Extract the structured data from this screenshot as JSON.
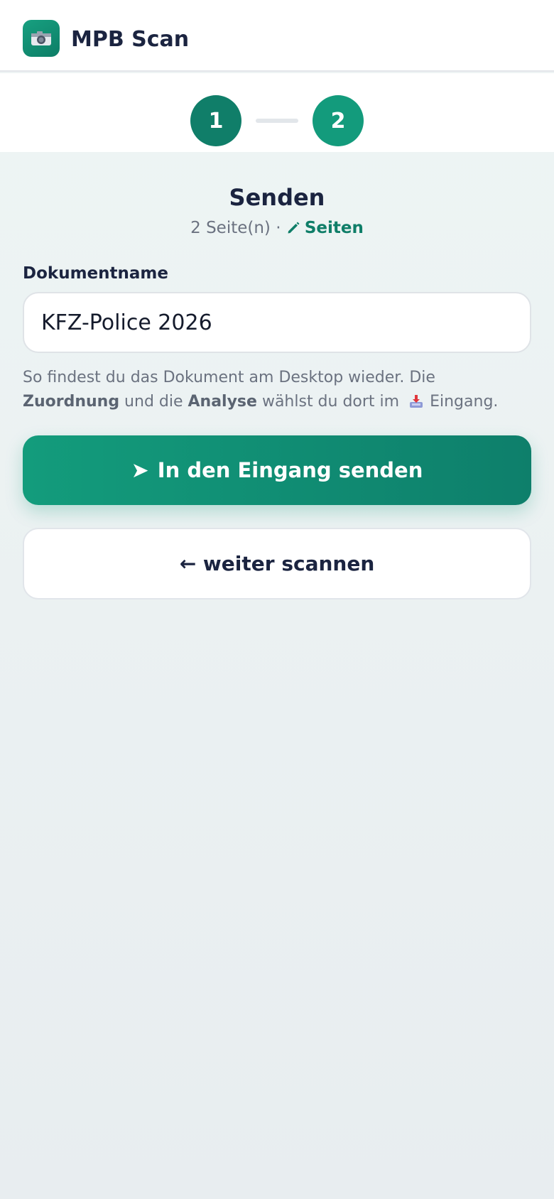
{
  "header": {
    "app_title": "MPB Scan",
    "icon": "camera-icon"
  },
  "stepper": {
    "steps": [
      "1",
      "2"
    ],
    "active_step": 2
  },
  "main": {
    "title": "Senden",
    "page_count": "2 Seite(n)",
    "separator": "·",
    "edit_pages_label": "Seiten",
    "field_label": "Dokumentname",
    "document_name": "KFZ-Police 2026",
    "hint": {
      "part1": "So findest du das Dokument am Desktop wieder. Die ",
      "bold1": "Zuordnung",
      "part2": " und die ",
      "bold2": "Analyse",
      "part3": " wählst du dort im ",
      "part4": "Eingang."
    },
    "send_arrow": "➤",
    "send_label": "In den Eingang senden",
    "rescan_label": "← weiter scannen"
  },
  "colors": {
    "primary": "#139b7c",
    "primary_dark": "#107e69",
    "text_dark": "#1b2440",
    "text_muted": "#6b7280"
  }
}
